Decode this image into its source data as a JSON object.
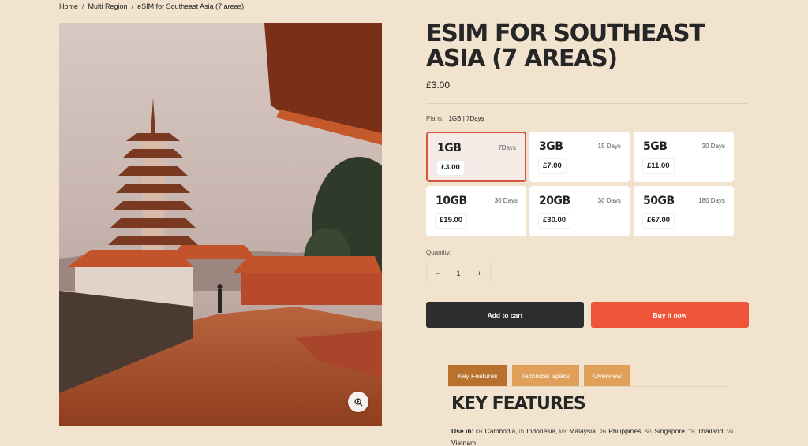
{
  "breadcrumb": {
    "items": [
      "Home",
      "Multi Region",
      "eSIM for Southeast Asia (7 areas)"
    ],
    "separator": "/"
  },
  "product": {
    "title": "ESIM FOR SOUTHEAST ASIA (7 AREAS)",
    "price": "£3.00"
  },
  "plans": {
    "label": "Plans:",
    "selected_value": "1GB | 7Days",
    "items": [
      {
        "gb": "1GB",
        "days": "7Days",
        "price": "£3.00",
        "selected": true
      },
      {
        "gb": "3GB",
        "days": "15 Days",
        "price": "£7.00",
        "selected": false
      },
      {
        "gb": "5GB",
        "days": "30 Days",
        "price": "£11.00",
        "selected": false
      },
      {
        "gb": "10GB",
        "days": "30 Days",
        "price": "£19.00",
        "selected": false
      },
      {
        "gb": "20GB",
        "days": "30 Days",
        "price": "£30.00",
        "selected": false
      },
      {
        "gb": "50GB",
        "days": "180 Days",
        "price": "£67.00",
        "selected": false
      }
    ]
  },
  "quantity": {
    "label": "Quantity:",
    "value": "1",
    "minus": "−",
    "plus": "+"
  },
  "buttons": {
    "add_to_cart": "Add to cart",
    "buy_now": "Buy it now"
  },
  "tabs": [
    "Key Features",
    "Technical Specs",
    "Overview"
  ],
  "key_features": {
    "title": "KEY FEATURES",
    "use_in_label": "Use in:",
    "countries": [
      {
        "code": "KH",
        "name": "Cambodia"
      },
      {
        "code": "ID",
        "name": "Indonesia"
      },
      {
        "code": "MY",
        "name": "Malaysia"
      },
      {
        "code": "PH",
        "name": "Philippines"
      },
      {
        "code": "SG",
        "name": "Singapore"
      },
      {
        "code": "TH",
        "name": "Thailand"
      },
      {
        "code": "VN",
        "name": "Vietnam"
      }
    ]
  },
  "colors": {
    "background": "#f1e3cd",
    "accent": "#ee5437",
    "dark_button": "#2e2e2e",
    "tab_active": "#b8722e",
    "tab": "#e1a05a",
    "selected_border": "#d4563d"
  },
  "icons": {
    "zoom": "zoom-in-icon"
  }
}
